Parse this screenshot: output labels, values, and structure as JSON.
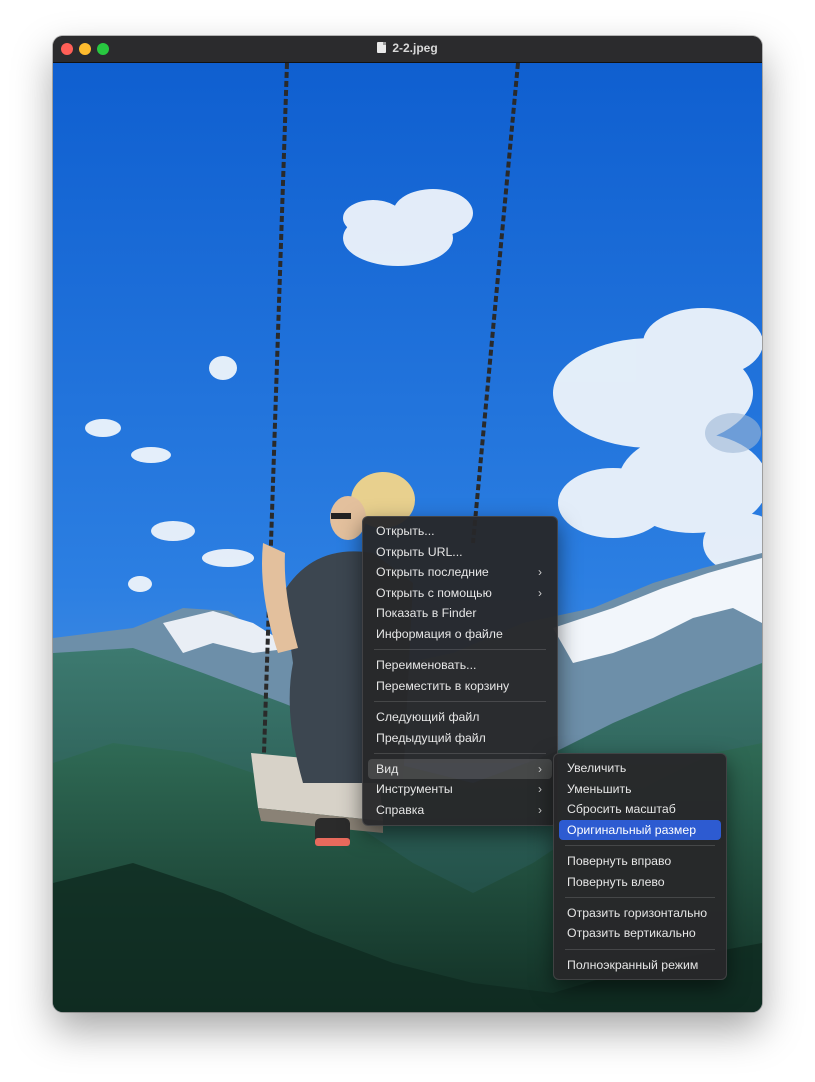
{
  "window": {
    "title": "2-2.jpeg",
    "file_icon": "document-icon"
  },
  "context_menu": {
    "groups": [
      [
        {
          "label": "Открыть..."
        },
        {
          "label": "Открыть URL..."
        },
        {
          "label": "Открыть последние",
          "submenu": true
        },
        {
          "label": "Открыть с помощью",
          "submenu": true
        },
        {
          "label": "Показать в Finder"
        },
        {
          "label": "Информация о файле"
        }
      ],
      [
        {
          "label": "Переименовать..."
        },
        {
          "label": "Переместить в корзину"
        }
      ],
      [
        {
          "label": "Следующий файл"
        },
        {
          "label": "Предыдущий файл"
        }
      ],
      [
        {
          "label": "Вид",
          "submenu": true,
          "highlighted": true
        },
        {
          "label": "Инструменты",
          "submenu": true
        },
        {
          "label": "Справка",
          "submenu": true
        }
      ]
    ]
  },
  "submenu_view": {
    "groups": [
      [
        {
          "label": "Увеличить"
        },
        {
          "label": "Уменьшить"
        },
        {
          "label": "Сбросить масштаб"
        },
        {
          "label": "Оригинальный размер",
          "selected": true
        }
      ],
      [
        {
          "label": "Повернуть вправо"
        },
        {
          "label": "Повернуть влево"
        }
      ],
      [
        {
          "label": "Отразить горизонтально"
        },
        {
          "label": "Отразить вертикально"
        }
      ],
      [
        {
          "label": "Полноэкранный режим"
        }
      ]
    ]
  },
  "colors": {
    "selection": "#2d5bd1",
    "menu_bg": "#28282a",
    "sky": "#1f6fd6"
  }
}
